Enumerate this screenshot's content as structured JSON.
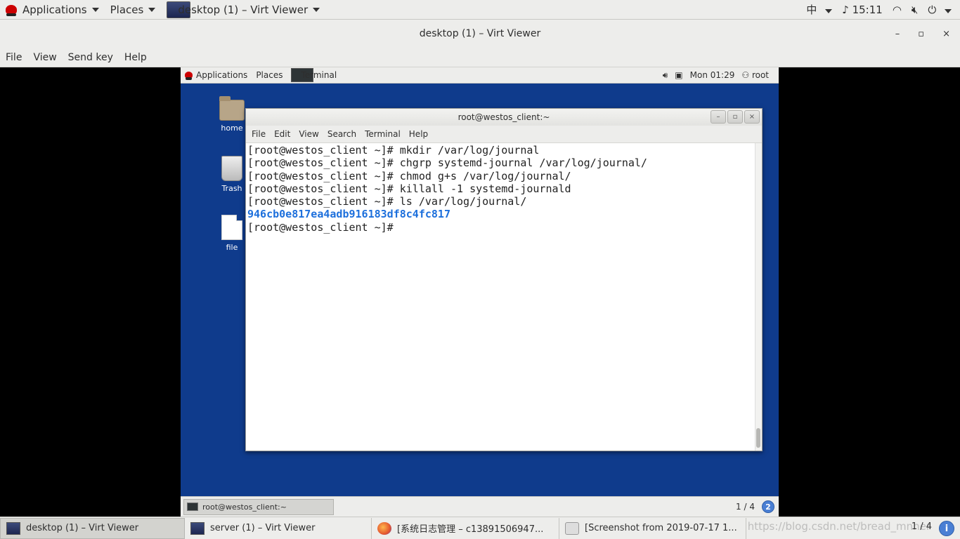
{
  "host_panel": {
    "applications": "Applications",
    "places": "Places",
    "active_window": "desktop (1) – Virt Viewer",
    "input_method": "中",
    "time": "15:11"
  },
  "viewer": {
    "title": "desktop (1) – Virt Viewer",
    "controls": {
      "minimize": "–",
      "maximize": "▫",
      "close": "×"
    },
    "menu": [
      "File",
      "View",
      "Send key",
      "Help"
    ]
  },
  "guest_panel": {
    "applications": "Applications",
    "places": "Places",
    "active_app": "Terminal",
    "clock": "Mon 01:29",
    "user": "root"
  },
  "desktop_icons": {
    "home": "home",
    "trash": "Trash",
    "file": "file"
  },
  "terminal": {
    "title": "root@westos_client:~",
    "menu": [
      "File",
      "Edit",
      "View",
      "Search",
      "Terminal",
      "Help"
    ],
    "lines": [
      "[root@westos_client ~]# mkdir /var/log/journal",
      "[root@westos_client ~]# chgrp systemd-journal /var/log/journal/",
      "[root@westos_client ~]# chmod g+s /var/log/journal/",
      "[root@westos_client ~]# killall -1 systemd-journald",
      "[root@westos_client ~]# ls /var/log/journal/",
      "946cb0e817ea4adb916183df8c4fc817",
      "[root@westos_client ~]# "
    ]
  },
  "guest_bottom": {
    "task": "root@westos_client:~",
    "workspace": "1 / 4",
    "badge": "2"
  },
  "host_taskbar": {
    "tasks": [
      "desktop (1) – Virt Viewer",
      "server (1) – Virt Viewer",
      "[系统日志管理 – c13891506947...",
      "[Screenshot from 2019-07-17 1..."
    ],
    "watermark": "https://blog.csdn.net/bread_mnner",
    "workspace": "1 / 4"
  },
  "colors": {
    "guest_desktop": "#0f3b8c",
    "terminal_highlight": "#1c6fdc"
  }
}
